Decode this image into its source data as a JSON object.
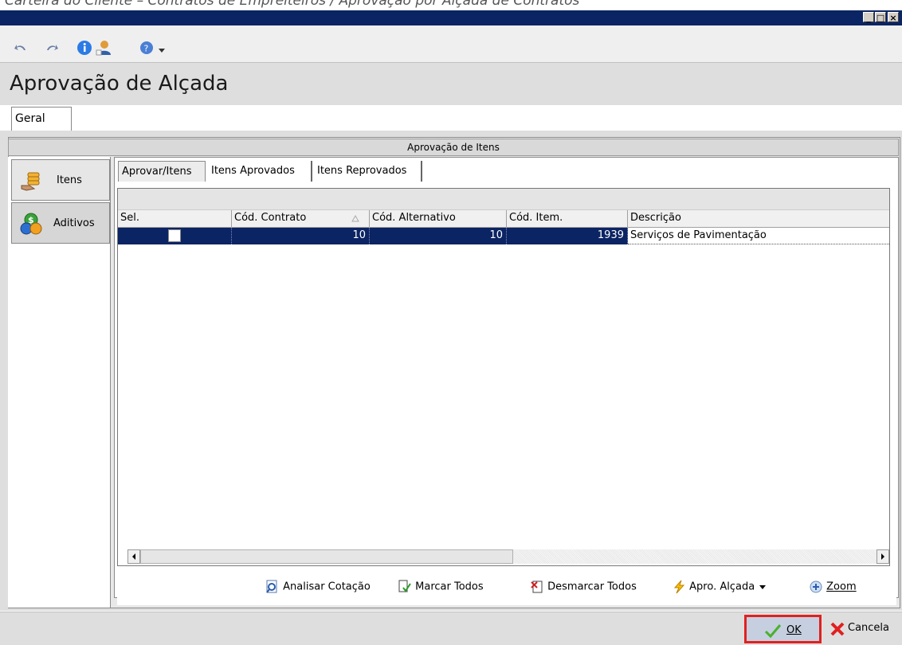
{
  "window": {
    "caption": "Carteira do Cliente – Contratos de Empreiteiros / Aprovação por Alçada de Contratos",
    "min_glyph": "_",
    "max_glyph": "□",
    "close_glyph": "×"
  },
  "toolbar": {
    "icons": [
      "undo-icon",
      "redo-icon",
      "info-icon",
      "user-icon",
      "help-icon",
      "dropdown-arrow-icon"
    ]
  },
  "page": {
    "title": "Aprovação de Alçada"
  },
  "tabs": [
    {
      "label": "Geral"
    }
  ],
  "section": {
    "title": "Aprovação de Itens"
  },
  "sidebar": {
    "items": [
      {
        "label": "Itens",
        "icon": "coins-hand-icon"
      },
      {
        "label": "Aditivos",
        "icon": "currency-icon"
      }
    ]
  },
  "subtabs": [
    {
      "label": "Aprovar/Itens"
    },
    {
      "label": "Itens Aprovados"
    },
    {
      "label": "Itens Reprovados"
    }
  ],
  "grid": {
    "columns": [
      "Sel.",
      "Cód. Contrato",
      "Cód. Alternativo",
      "Cód. Item.",
      "Descrição"
    ],
    "rows": [
      {
        "sel": false,
        "contrato": "10",
        "alternativo": "10",
        "item": "1939",
        "descricao": "Serviços de Pavimentação"
      }
    ]
  },
  "actions": {
    "analisar": "Analisar Cotação",
    "marcar": "Marcar Todos",
    "desmarcar": "Desmarcar Todos",
    "apro": "Apro. Alçada",
    "zoom": "Zoom"
  },
  "footer": {
    "ok": "OK",
    "cancel": "Cancela"
  },
  "colors": {
    "title_bar": "#0b2463",
    "selection": "#0b2463",
    "highlight": "#e0211f"
  }
}
